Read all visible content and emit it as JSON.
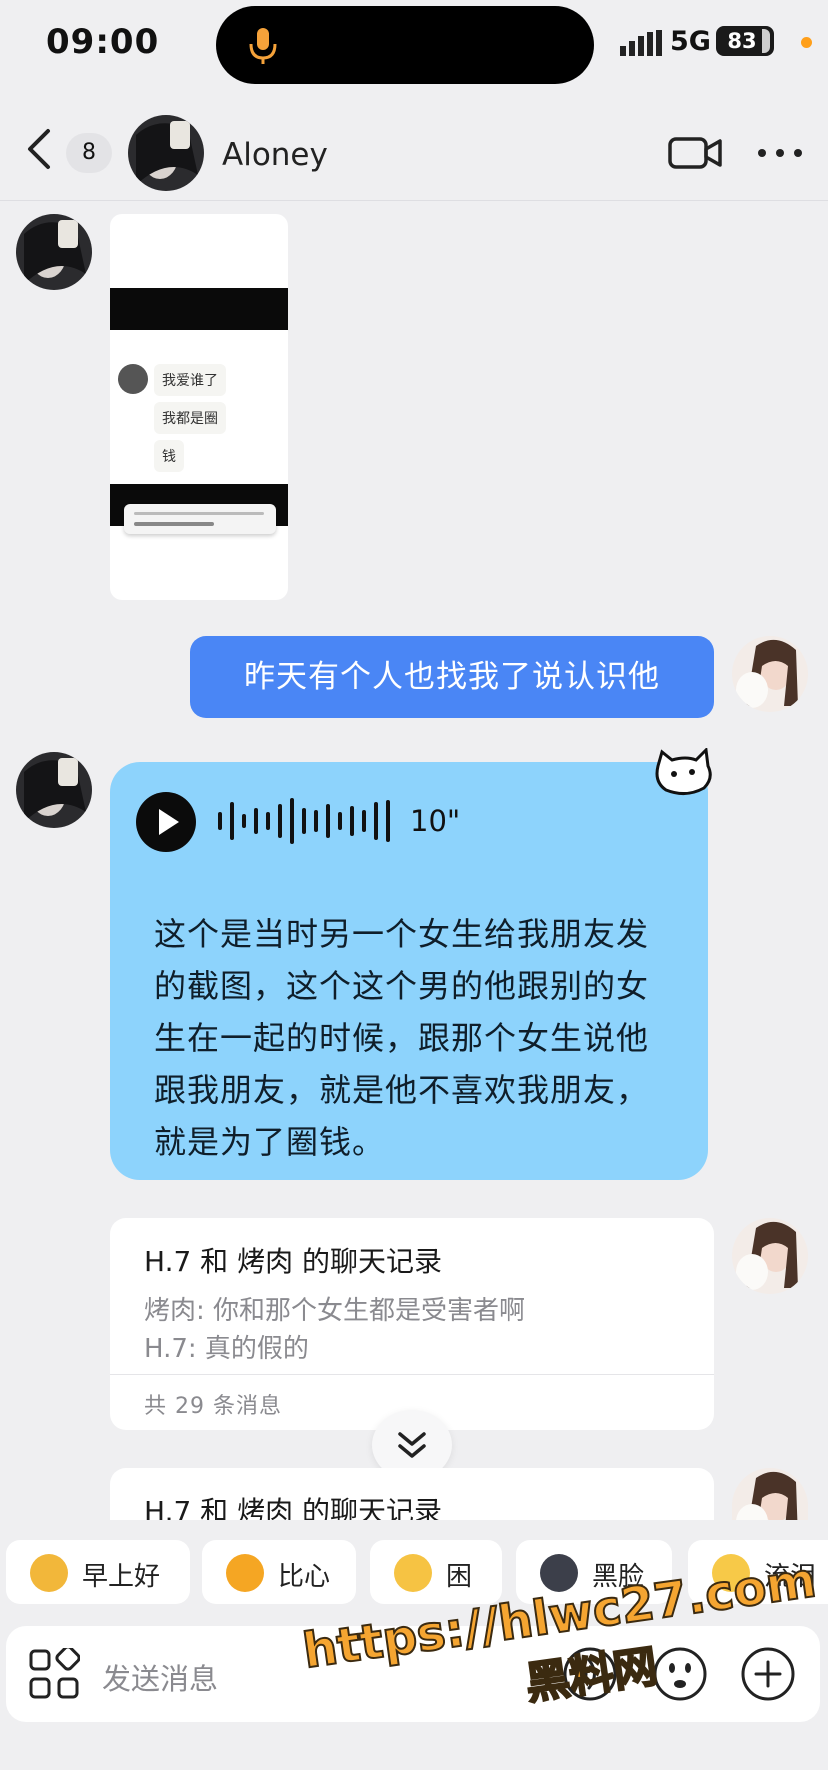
{
  "status_bar": {
    "time": "09:00",
    "network": "5G",
    "battery": "83"
  },
  "header": {
    "unread_count": "8",
    "contact_name": "Aloney"
  },
  "image_message": {
    "lines": [
      "我爱谁了",
      "我都是圈",
      "钱"
    ]
  },
  "outgoing_text": "昨天有个人也找我了说认识他",
  "voice_message": {
    "duration": "10\"",
    "transcript": "这个是当时另一个女生给我朋友发的截图，这个这个男的他跟别的女生在一起的时候，跟那个女生说他跟我朋友，就是他不喜欢我朋友，就是为了圈钱。"
  },
  "chat_records": [
    {
      "title": "H.7 和 烤肉 的聊天记录",
      "line1": "烤肉: 你和那个女生都是受害者啊",
      "line2": "H.7: 真的假的",
      "count": "共 29 条消息"
    },
    {
      "title": "H.7 和 烤肉 的聊天记录"
    }
  ],
  "quick_replies": [
    {
      "label": "早上好",
      "color": "#f2b73a"
    },
    {
      "label": "比心",
      "color": "#f5a623"
    },
    {
      "label": "困",
      "color": "#f6c343"
    },
    {
      "label": "黑脸",
      "color": "#3c3f4a"
    },
    {
      "label": "流泪",
      "color": "#f7c948"
    }
  ],
  "input": {
    "placeholder": "发送消息"
  },
  "watermark": {
    "line1": "https://hlwc27.com",
    "line2": "黑料网"
  },
  "colors": {
    "outgoing_bubble": "#4a86f5",
    "voice_bubble": "#8dd3fc",
    "background": "#efeff1"
  }
}
